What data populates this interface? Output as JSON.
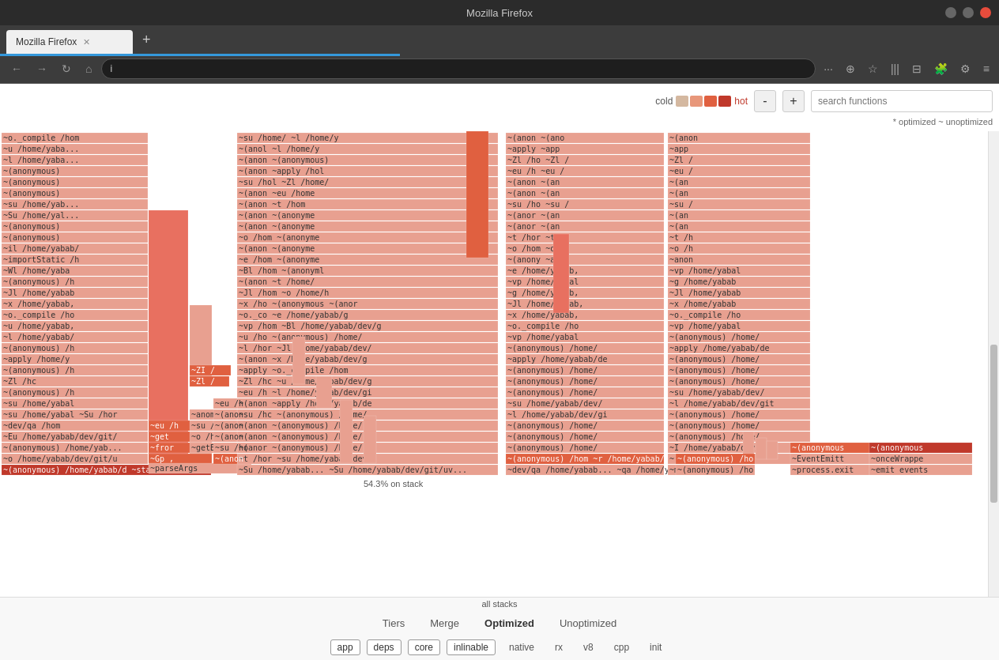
{
  "browser": {
    "title": "Mozilla Firefox",
    "tab_label": "Mozilla Firefox",
    "address_bar_text": "i",
    "new_tab_label": "+",
    "nav": {
      "back": "←",
      "forward": "→",
      "reload": "↻",
      "home": "⌂"
    },
    "toolbar": {
      "more": "···",
      "pocket": "⊕",
      "bookmark": "☆",
      "library": "|||",
      "sidebar": "⊟",
      "extensions": "🧩",
      "menu": "≡"
    }
  },
  "flamegraph": {
    "legend": {
      "cold_label": "cold",
      "hot_label": "hot",
      "cold_color": "#d4b8a0",
      "warm1_color": "#e8977a",
      "warm2_color": "#e06040",
      "hot_color": "#c0392b",
      "optimized_label": "* optimized ~ unoptimized"
    },
    "controls": {
      "zoom_minus": "-",
      "zoom_plus": "+",
      "search_placeholder": "search functions"
    },
    "status": "54.3% on stack",
    "all_stacks_label": "all stacks",
    "tabs": [
      "Tiers",
      "Merge",
      "Optimized",
      "Unoptimized"
    ],
    "active_tab": "Optimized",
    "filters": [
      {
        "label": "app",
        "active": true
      },
      {
        "label": "deps",
        "active": true
      },
      {
        "label": "core",
        "active": true
      },
      {
        "label": "inlinable",
        "active": true
      },
      {
        "label": "native",
        "active": false
      },
      {
        "label": "rx",
        "active": false
      },
      {
        "label": "v8",
        "active": false
      },
      {
        "label": "cpp",
        "active": false
      },
      {
        "label": "init",
        "active": false
      }
    ]
  }
}
